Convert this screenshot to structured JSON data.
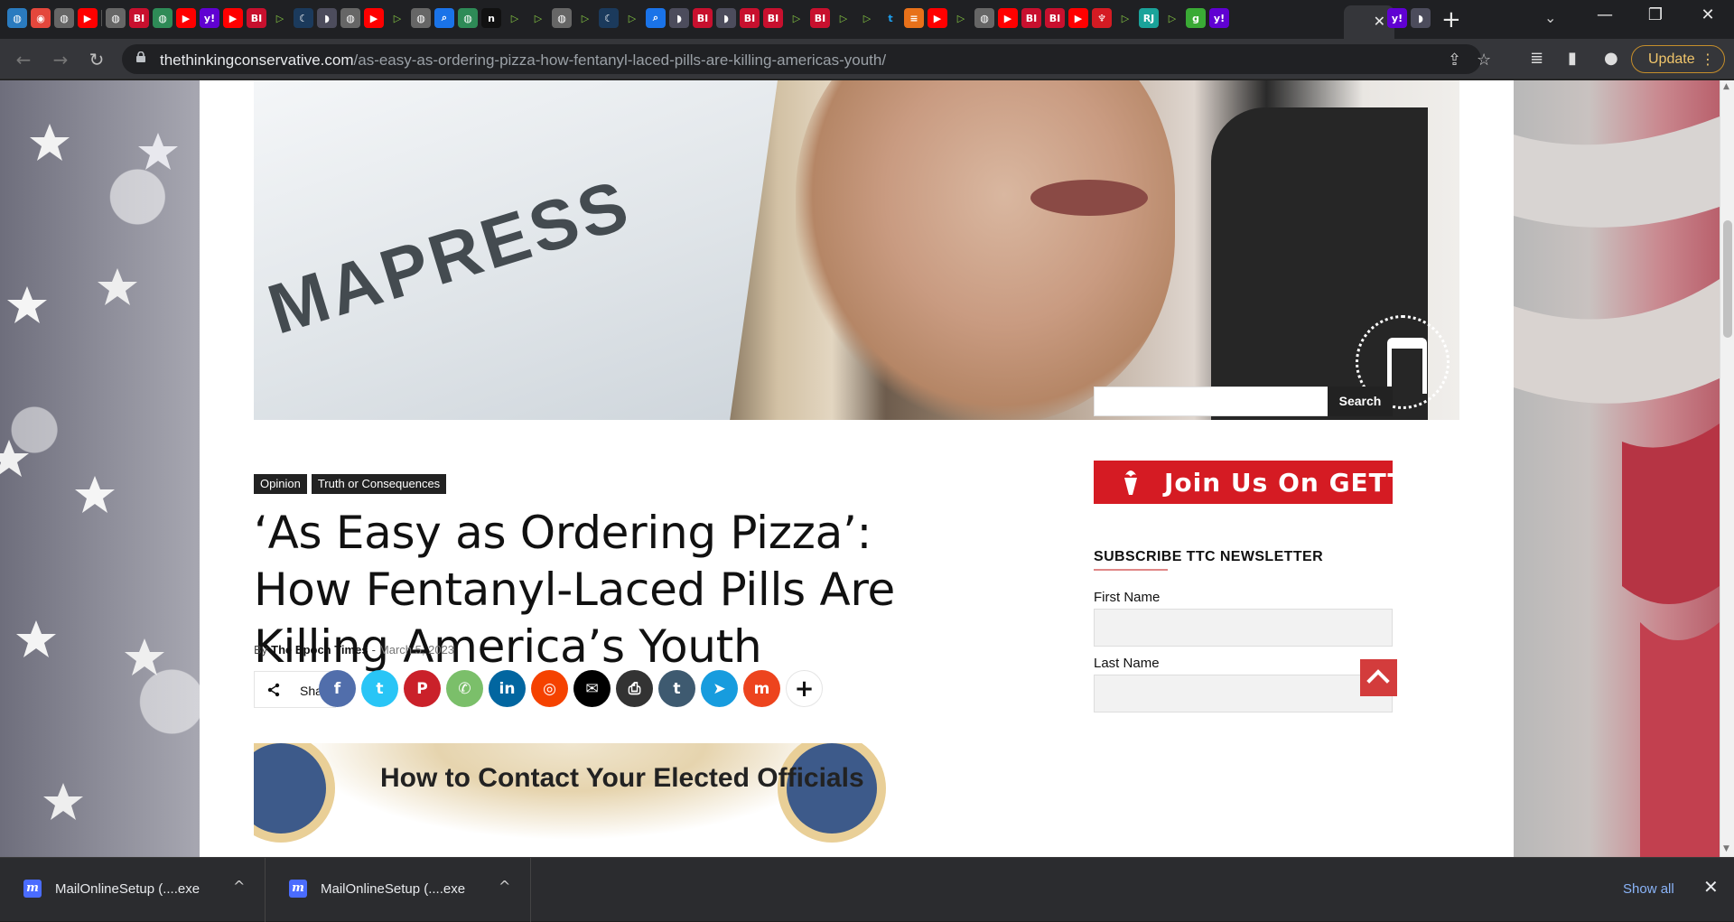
{
  "browser": {
    "tab_icons": [
      {
        "name": "globe-tab-icon",
        "glyph": "◍",
        "color": "#2a7bbf"
      },
      {
        "name": "pizza-tab-icon",
        "glyph": "◉",
        "color": "#e4473c"
      },
      {
        "name": "globe-tab-icon",
        "glyph": "◍",
        "color": "#666"
      },
      {
        "name": "youtube-tab-icon",
        "glyph": "▶",
        "color": "#ff0000"
      },
      {
        "name": "sep",
        "glyph": "",
        "color": ""
      },
      {
        "name": "globe-tab-icon",
        "glyph": "◍",
        "color": "#666"
      },
      {
        "name": "business-insider-tab-icon",
        "glyph": "BI",
        "color": "#c8102e"
      },
      {
        "name": "globe-tab-icon",
        "glyph": "◍",
        "color": "#2e8b57"
      },
      {
        "name": "youtube-tab-icon",
        "glyph": "▶",
        "color": "#ff0000"
      },
      {
        "name": "yahoo-tab-icon",
        "glyph": "y!",
        "color": "#6001d2"
      },
      {
        "name": "youtube-tab-icon",
        "glyph": "▶",
        "color": "#ff0000"
      },
      {
        "name": "business-insider-tab-icon",
        "glyph": "BI",
        "color": "#c8102e"
      },
      {
        "name": "rumble-tab-icon",
        "glyph": "▷",
        "color": "#85c742"
      },
      {
        "name": "moon-tab-icon",
        "glyph": "☾",
        "color": "#1b3a5c"
      },
      {
        "name": "media-tab-icon",
        "glyph": "◗",
        "color": "#4c4c5c"
      },
      {
        "name": "globe-tab-icon",
        "glyph": "◍",
        "color": "#666"
      },
      {
        "name": "youtube-tab-icon",
        "glyph": "▶",
        "color": "#ff0000"
      },
      {
        "name": "rumble-tab-icon",
        "glyph": "▷",
        "color": "#85c742"
      },
      {
        "name": "globe-tab-icon",
        "glyph": "◍",
        "color": "#666"
      },
      {
        "name": "search-tab-icon",
        "glyph": "⌕",
        "color": "#1a73e8"
      },
      {
        "name": "globe-tab-icon",
        "glyph": "◍",
        "color": "#2e8b57"
      },
      {
        "name": "news-tab-icon",
        "glyph": "n",
        "color": "#111"
      },
      {
        "name": "rumble-tab-icon",
        "glyph": "▷",
        "color": "#85c742"
      },
      {
        "name": "rumble-tab-icon",
        "glyph": "▷",
        "color": "#85c742"
      },
      {
        "name": "globe-tab-icon",
        "glyph": "◍",
        "color": "#666"
      },
      {
        "name": "rumble-tab-icon",
        "glyph": "▷",
        "color": "#85c742"
      },
      {
        "name": "moon-tab-icon",
        "glyph": "☾",
        "color": "#1b3a5c"
      },
      {
        "name": "rumble-tab-icon",
        "glyph": "▷",
        "color": "#85c742"
      },
      {
        "name": "search-tab-icon",
        "glyph": "⌕",
        "color": "#1a73e8"
      },
      {
        "name": "media-tab-icon",
        "glyph": "◗",
        "color": "#4c4c5c"
      },
      {
        "name": "business-insider-tab-icon",
        "glyph": "BI",
        "color": "#c8102e"
      },
      {
        "name": "media-tab-icon",
        "glyph": "◗",
        "color": "#4c4c5c"
      },
      {
        "name": "business-insider-tab-icon",
        "glyph": "BI",
        "color": "#c8102e"
      },
      {
        "name": "business-insider-tab-icon",
        "glyph": "BI",
        "color": "#c8102e"
      },
      {
        "name": "rumble-tab-icon",
        "glyph": "▷",
        "color": "#85c742"
      },
      {
        "name": "business-insider-tab-icon",
        "glyph": "BI",
        "color": "#c8102e"
      },
      {
        "name": "rumble-tab-icon",
        "glyph": "▷",
        "color": "#85c742"
      },
      {
        "name": "rumble-tab-icon",
        "glyph": "▷",
        "color": "#85c742"
      },
      {
        "name": "twitter-tab-icon",
        "glyph": "t",
        "color": "#1da1f2"
      },
      {
        "name": "bookmark-tab-icon",
        "glyph": "≡",
        "color": "#e8711a"
      },
      {
        "name": "youtube-tab-icon",
        "glyph": "▶",
        "color": "#ff0000"
      },
      {
        "name": "rumble-tab-icon",
        "glyph": "▷",
        "color": "#85c742"
      },
      {
        "name": "globe-tab-icon",
        "glyph": "◍",
        "color": "#666"
      },
      {
        "name": "youtube-tab-icon",
        "glyph": "▶",
        "color": "#ff0000"
      },
      {
        "name": "business-insider-tab-icon",
        "glyph": "BI",
        "color": "#c8102e"
      },
      {
        "name": "business-insider-tab-icon",
        "glyph": "BI",
        "color": "#c8102e"
      },
      {
        "name": "youtube-tab-icon",
        "glyph": "▶",
        "color": "#ff0000"
      },
      {
        "name": "torch-tab-icon",
        "glyph": "♆",
        "color": "#d51b23"
      },
      {
        "name": "rumble-tab-icon",
        "glyph": "▷",
        "color": "#85c742"
      },
      {
        "name": "rj-tab-icon",
        "glyph": "RJ",
        "color": "#1aa39a"
      },
      {
        "name": "rumble-tab-icon",
        "glyph": "▷",
        "color": "#85c742"
      },
      {
        "name": "g-tab-icon",
        "glyph": "g",
        "color": "#3aaa35"
      },
      {
        "name": "yahoo-tab-icon",
        "glyph": "y!",
        "color": "#6001d2"
      }
    ],
    "extra_tab_icons": [
      {
        "name": "yahoo-tab-icon",
        "glyph": "y!",
        "color": "#6001d2"
      },
      {
        "name": "media-tab-icon",
        "glyph": "◗",
        "color": "#4c4c5c"
      }
    ],
    "active_tab_close": "✕",
    "new_tab": "+",
    "tab_search": "⌄",
    "window_controls": {
      "minimize": "—",
      "maximize": "❐",
      "close": "✕"
    },
    "nav": {
      "back": "←",
      "forward": "→",
      "reload": "↻"
    },
    "url_host": "thethinkingconservative.com",
    "url_path": "/as-easy-as-ordering-pizza-how-fentanyl-laced-pills-are-killing-americas-youth/",
    "omnibox_icons": {
      "share": "⇪",
      "star": "☆"
    },
    "toolbar_icons": {
      "media": "≣",
      "sidepanel": "▮",
      "profile": "●"
    },
    "update_label": "Update",
    "update_menu": "⋮"
  },
  "hero": {
    "paper_text": "MAPRESS"
  },
  "article": {
    "categories": [
      "Opinion",
      "Truth or Consequences"
    ],
    "title": "‘As Easy as Ordering Pizza’: How Fentanyl-Laced Pills Are Killing America’s Youth",
    "byline_prefix": "By",
    "author": "The Epoch Times",
    "separator": "-",
    "date": "March 5, 2023",
    "share_icon": "<",
    "share_label": "Share",
    "social_buttons": [
      {
        "name": "facebook-share-button",
        "glyph": "f",
        "color": "#516eab"
      },
      {
        "name": "twitter-share-button",
        "glyph": "t",
        "color": "#29c5f6"
      },
      {
        "name": "pinterest-share-button",
        "glyph": "P",
        "color": "#ca212a"
      },
      {
        "name": "whatsapp-share-button",
        "glyph": "✆",
        "color": "#7bbf6a"
      },
      {
        "name": "linkedin-share-button",
        "glyph": "in",
        "color": "#0266a0"
      },
      {
        "name": "reddit-share-button",
        "glyph": "◎",
        "color": "#f54200"
      },
      {
        "name": "email-share-button",
        "glyph": "✉",
        "color": "#000000"
      },
      {
        "name": "print-share-button",
        "glyph": "⎙",
        "color": "#333333"
      },
      {
        "name": "tumblr-share-button",
        "glyph": "t",
        "color": "#3e5a70"
      },
      {
        "name": "telegram-share-button",
        "glyph": "➤",
        "color": "#179cde"
      },
      {
        "name": "mix-share-button",
        "glyph": "m",
        "color": "#ed441e"
      },
      {
        "name": "more-share-button",
        "glyph": "+",
        "color": "#ffffff"
      }
    ],
    "contact_banner_text": "How to Contact Your Elected Officials"
  },
  "sidebar": {
    "search_placeholder": "",
    "search_button": "Search",
    "gettr_text": "Join Us On GETTR",
    "newsletter_heading": "SUBSCRIBE TTC NEWSLETTER",
    "first_name_label": "First Name",
    "last_name_label": "Last Name"
  },
  "downloads": {
    "items": [
      {
        "name": "MailOnlineSetup (....exe"
      },
      {
        "name": "MailOnlineSetup (....exe"
      }
    ],
    "show_all": "Show all",
    "close": "✕"
  }
}
